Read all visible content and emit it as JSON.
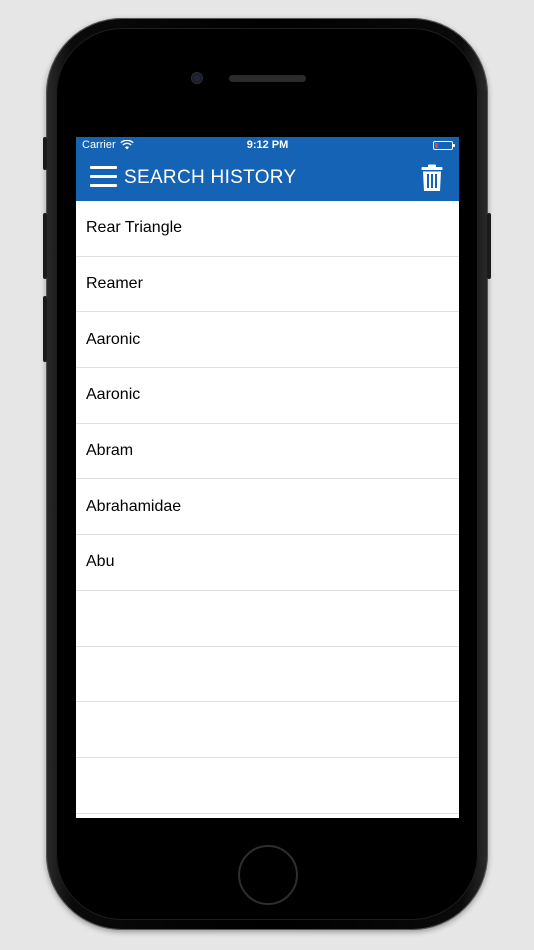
{
  "status_bar": {
    "carrier": "Carrier",
    "time": "9:12 PM",
    "battery_icon": "battery-low-icon",
    "wifi_icon": "wifi-icon"
  },
  "nav_bar": {
    "title": "SEARCH HISTORY",
    "menu_icon": "hamburger-menu-icon",
    "trash_icon": "trash-icon",
    "color": "#1563b5"
  },
  "history": {
    "items": [
      {
        "label": "Rear Triangle"
      },
      {
        "label": "Reamer"
      },
      {
        "label": "Aaronic"
      },
      {
        "label": "Aaronic"
      },
      {
        "label": "Abram"
      },
      {
        "label": "Abrahamidae"
      },
      {
        "label": "Abu"
      },
      {
        "label": ""
      },
      {
        "label": ""
      },
      {
        "label": ""
      },
      {
        "label": ""
      }
    ]
  }
}
